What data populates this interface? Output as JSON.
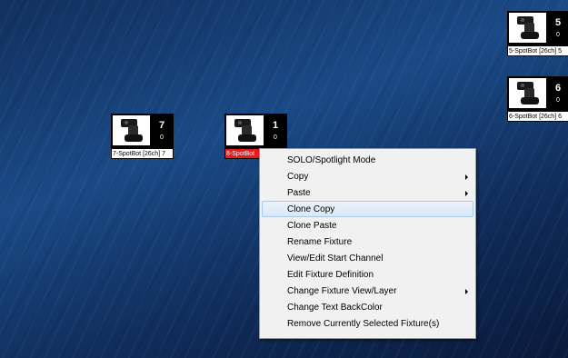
{
  "fixtures": [
    {
      "id": "fixture-7",
      "number": "7",
      "value": "0",
      "label": "7-SpotBot [26ch] 7",
      "selected": false
    },
    {
      "id": "fixture-1",
      "number": "1",
      "value": "0",
      "label": "8-SpotBot",
      "selected": true
    },
    {
      "id": "fixture-5",
      "number": "5",
      "value": "0",
      "label": "5-SpotBot [26ch] 5",
      "selected": false
    },
    {
      "id": "fixture-6",
      "number": "6",
      "value": "0",
      "label": "6-SpotBot [26ch] 6",
      "selected": false
    }
  ],
  "context_menu": {
    "items": [
      {
        "label": "SOLO/Spotlight Mode",
        "submenu": false,
        "highlighted": false
      },
      {
        "label": "Copy",
        "submenu": true,
        "highlighted": false
      },
      {
        "label": "Paste",
        "submenu": true,
        "highlighted": false
      },
      {
        "label": "Clone Copy",
        "submenu": false,
        "highlighted": true
      },
      {
        "label": "Clone Paste",
        "submenu": false,
        "highlighted": false
      },
      {
        "label": "Rename Fixture",
        "submenu": false,
        "highlighted": false
      },
      {
        "label": "View/Edit Start Channel",
        "submenu": false,
        "highlighted": false
      },
      {
        "label": "Edit Fixture Definition",
        "submenu": false,
        "highlighted": false
      },
      {
        "label": "Change Fixture View/Layer",
        "submenu": true,
        "highlighted": false
      },
      {
        "label": "Change Text BackColor",
        "submenu": false,
        "highlighted": false
      },
      {
        "label": "Remove Currently Selected Fixture(s)",
        "submenu": false,
        "highlighted": false
      }
    ]
  },
  "colors": {
    "selected_label_bg": "#e81a1a",
    "menu_bg": "#f1f1f1",
    "menu_hover_border": "#aac9ee"
  },
  "icons": {
    "fixture_icon": "moving-head-spotlight-icon",
    "submenu_arrow": "chevron-right-icon"
  }
}
